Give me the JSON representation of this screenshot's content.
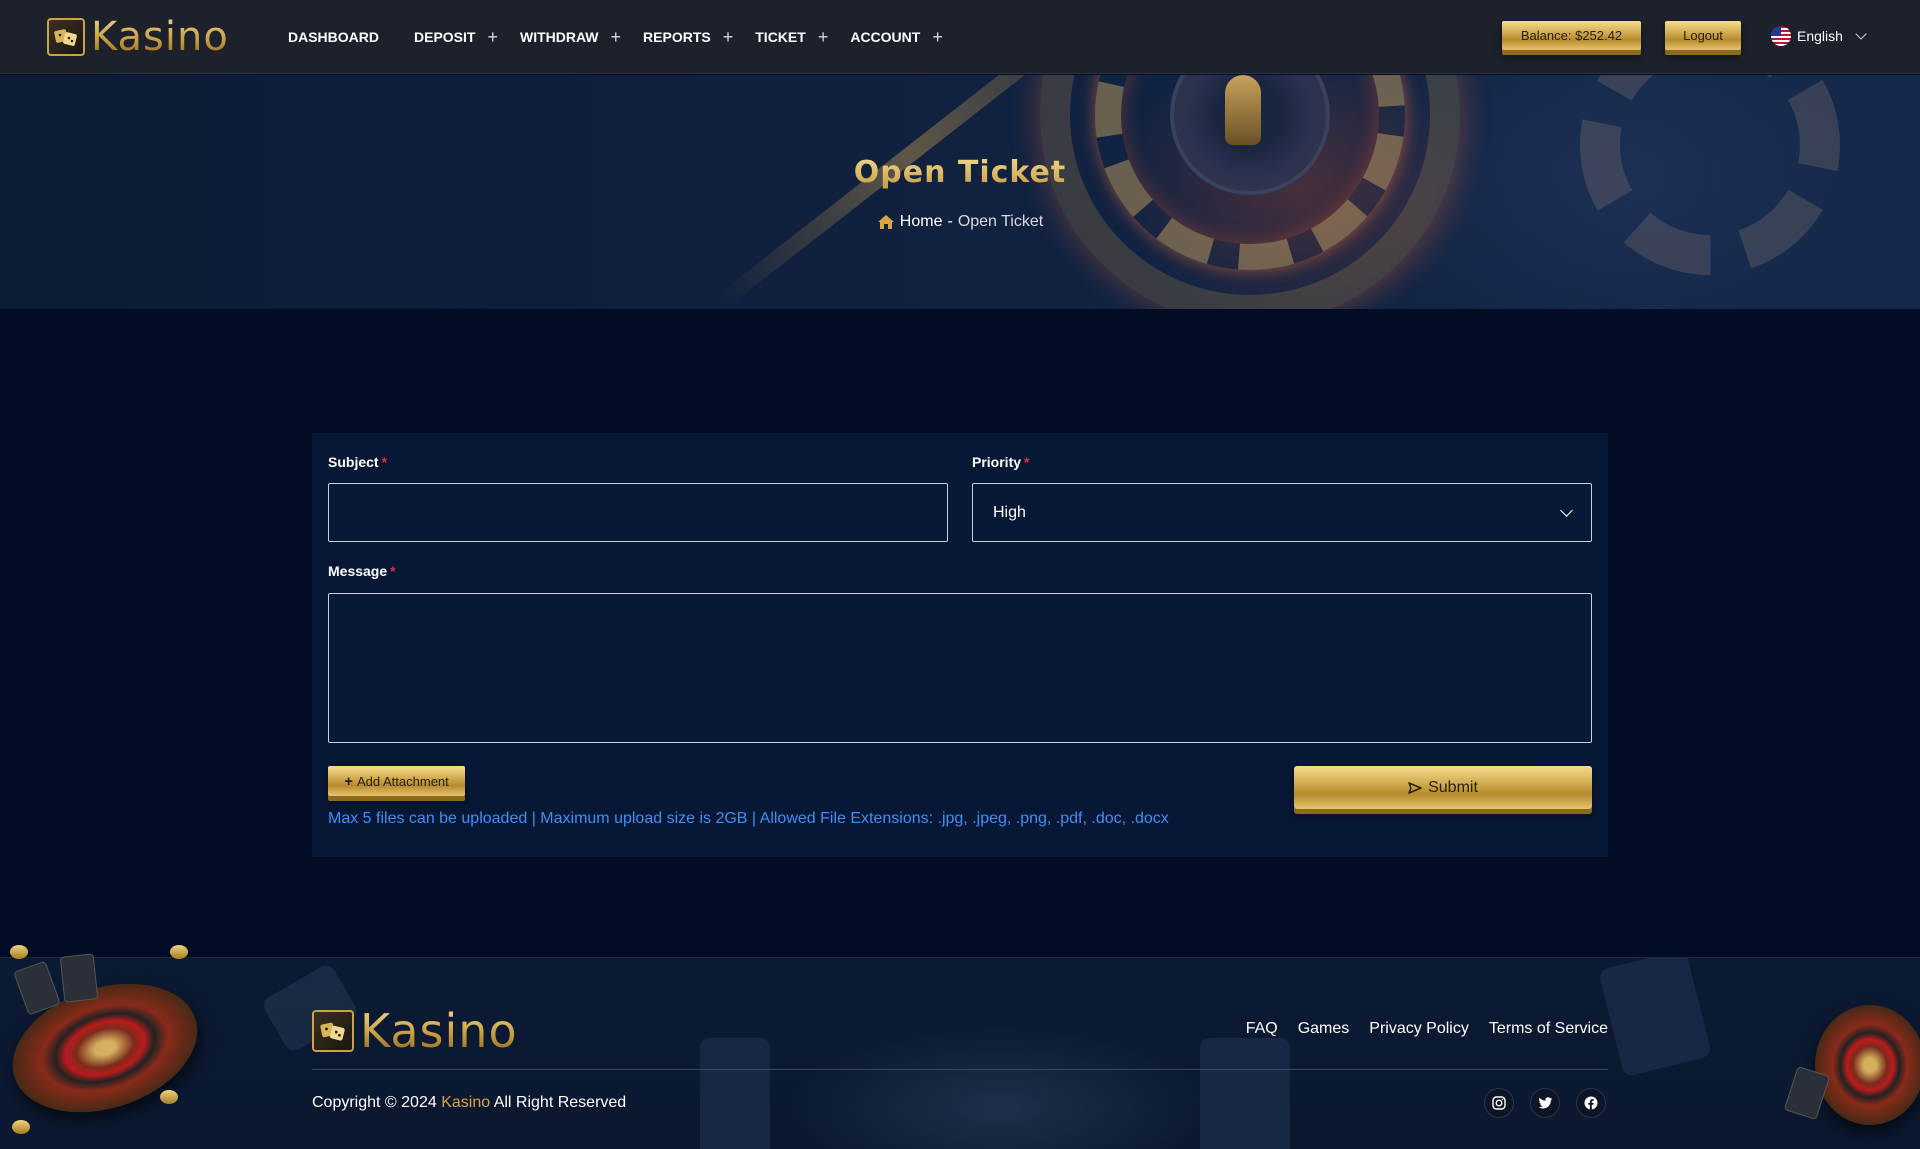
{
  "brand": {
    "name": "Kasino"
  },
  "nav": {
    "items": [
      {
        "label": "DASHBOARD",
        "has_submenu": false
      },
      {
        "label": "DEPOSIT",
        "has_submenu": true
      },
      {
        "label": "WITHDRAW",
        "has_submenu": true
      },
      {
        "label": "REPORTS",
        "has_submenu": true
      },
      {
        "label": "TICKET",
        "has_submenu": true
      },
      {
        "label": "ACCOUNT",
        "has_submenu": true
      }
    ],
    "submenu_symbol": "+"
  },
  "header": {
    "balance_label": "Balance: $252.42",
    "logout_label": "Logout",
    "language": "English"
  },
  "banner": {
    "title": "Open Ticket",
    "breadcrumb_home": "Home",
    "breadcrumb_sep": "-",
    "breadcrumb_current": "Open Ticket"
  },
  "form": {
    "subject_label": "Subject",
    "subject_value": "",
    "priority_label": "Priority",
    "priority_selected": "High",
    "message_label": "Message",
    "message_value": "",
    "required_mark": "*",
    "attach_label": "Add Attachment",
    "submit_label": "Submit",
    "upload_note": "Max 5 files can be uploaded | Maximum upload size is 2GB | Allowed File Extensions: .jpg, .jpeg, .png, .pdf, .doc, .docx"
  },
  "footer": {
    "links": [
      "FAQ",
      "Games",
      "Privacy Policy",
      "Terms of Service"
    ],
    "copyright_prefix": "Copyright © 2024",
    "copyright_brand": "Kasino",
    "copyright_suffix": "All Right Reserved",
    "socials": [
      "instagram-icon",
      "twitter-icon",
      "facebook-icon"
    ]
  },
  "colors": {
    "accent_gold": "#d7b35a",
    "background": "#020c24",
    "card": "#071836",
    "note_blue": "#3d8ff5",
    "required_red": "#e03040"
  }
}
